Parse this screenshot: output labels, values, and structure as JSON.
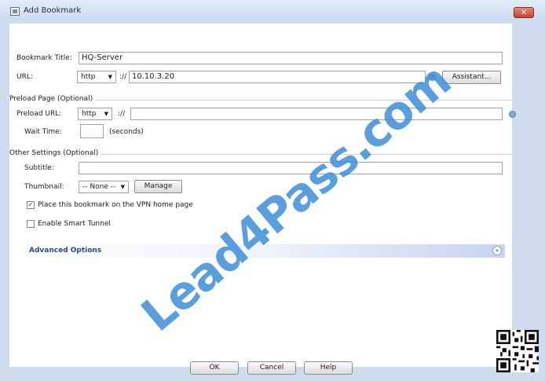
{
  "window": {
    "title": "Add Bookmark",
    "close_glyph": "✕"
  },
  "bookmark_title": {
    "label": "Bookmark Title:",
    "value": "HQ-Server"
  },
  "url": {
    "label": "URL:",
    "protocol": "http",
    "separator": "://",
    "value": "10.10.3.20",
    "assistant_label": "Assistant..."
  },
  "preload": {
    "legend": "Preload Page (Optional)",
    "url_label": "Preload URL:",
    "protocol": "http",
    "separator": "://",
    "value": "",
    "wait_label": "Wait Time:",
    "wait_value": "",
    "wait_unit": "(seconds)"
  },
  "other": {
    "legend": "Other Settings (Optional)",
    "subtitle_label": "Subtitle:",
    "subtitle_value": "",
    "thumbnail_label": "Thumbnail:",
    "thumbnail_value": "-- None --",
    "manage_label": "Manage",
    "place_on_home_label": "Place this bookmark on the VPN home page",
    "place_on_home_checked": true,
    "smart_tunnel_label": "Enable Smart Tunnel",
    "smart_tunnel_checked": false
  },
  "advanced": {
    "label": "Advanced Options"
  },
  "footer": {
    "ok": "OK",
    "cancel": "Cancel",
    "help": "Help"
  },
  "watermark_text": "Lead4Pass.com",
  "icons": {
    "info": "info-icon",
    "qr": "qr-code"
  },
  "colors": {
    "titlebar": "#c9d9ee",
    "watermark": "#3d8fd8",
    "advanced_bar": "#c7d3f0"
  }
}
